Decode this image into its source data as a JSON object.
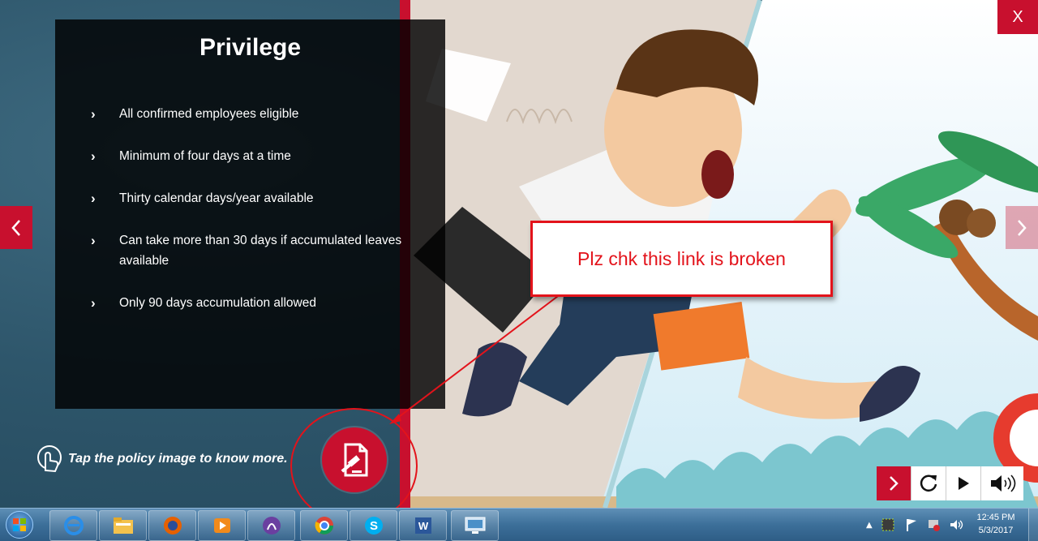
{
  "panel": {
    "title": "Privilege",
    "bullets": [
      "All confirmed employees eligible",
      "Minimum of four days at a time",
      "Thirty calendar days/year available",
      "Can take more than 30 days if accumulated leaves available",
      "Only 90 days accumulation allowed"
    ]
  },
  "hint": {
    "text": "Tap the policy image to know more."
  },
  "annotation": {
    "text": "Plz chk this link is broken"
  },
  "nav": {
    "close_label": "X"
  },
  "controls": [
    "next-icon",
    "replay-icon",
    "play-icon",
    "volume-icon"
  ],
  "taskbar": {
    "apps": [
      "internet-explorer-icon",
      "file-explorer-icon",
      "firefox-icon",
      "media-player-icon",
      "torrent-icon",
      "chrome-icon",
      "skype-icon",
      "word-icon",
      "remote-desktop-icon"
    ],
    "time": "12:45 PM",
    "date": "5/3/2017"
  },
  "colors": {
    "accent": "#c8102e",
    "annotation": "#e3131b"
  }
}
